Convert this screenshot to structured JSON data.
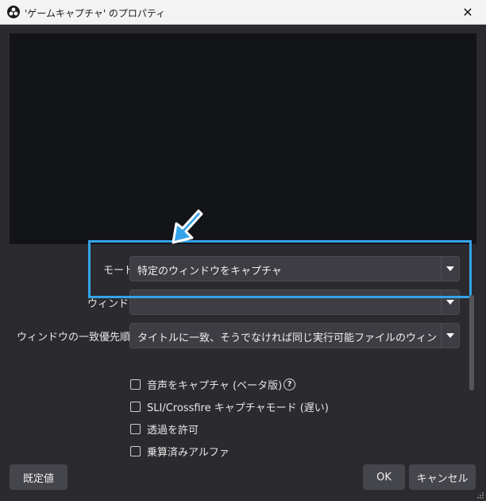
{
  "window": {
    "title": "'ゲームキャプチャ' のプロパティ",
    "close_glyph": "✕"
  },
  "form": {
    "mode": {
      "label": "モード",
      "value": "特定のウィンドウをキャプチャ"
    },
    "window": {
      "label": "ウィンドウ",
      "value": ""
    },
    "priority": {
      "label": "ウィンドウの一致優先順位",
      "value": "タイトルに一致、そうでなければ同じ実行可能ファイルのウィンドウを見つける"
    }
  },
  "checkboxes": [
    {
      "label": "音声をキャプチャ (ベータ版)",
      "checked": false,
      "help": "?"
    },
    {
      "label": "SLI/Crossfire キャプチャモード (遅い)",
      "checked": false
    },
    {
      "label": "透過を許可",
      "checked": false
    },
    {
      "label": "乗算済みアルファ",
      "checked": false
    }
  ],
  "buttons": {
    "defaults": "既定値",
    "ok": "OK",
    "cancel": "キャンセル"
  },
  "colors": {
    "highlight": "#34a3ea",
    "background": "#2b2b2f",
    "preview": "#131418"
  },
  "icons": [
    "obs-logo-icon",
    "close-icon",
    "chevron-down-icon",
    "help-icon",
    "annotation-arrow-icon",
    "resize-grip-icon"
  ]
}
